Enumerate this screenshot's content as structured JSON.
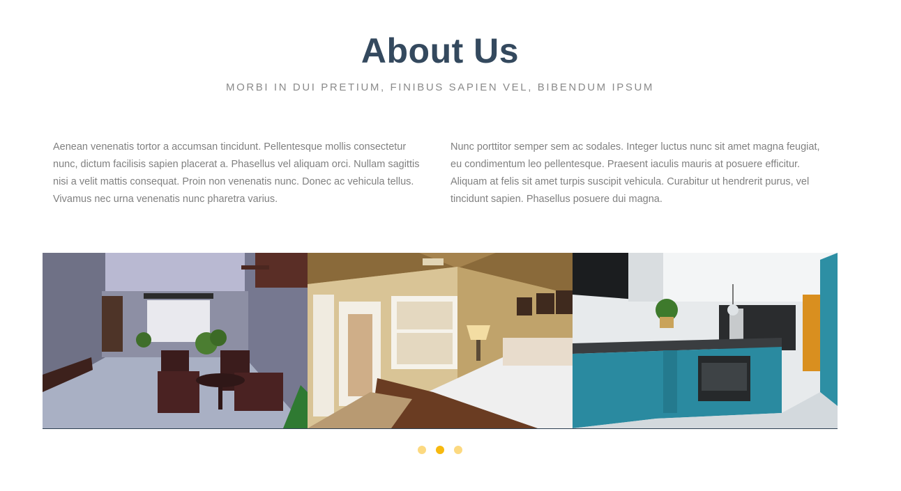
{
  "section": {
    "title": "About Us",
    "subtitle": "MORBI IN DUI PRETIUM, FINIBUS SAPIEN VEL, BIBENDUM IPSUM"
  },
  "columns": [
    {
      "text": "Aenean venenatis tortor a accumsan tincidunt. Pellentesque mollis consectetur nunc, dictum facilisis sapien placerat a. Phasellus vel aliquam orci. Nullam sagittis nisi a velit mattis consequat. Proin non venenatis nunc. Donec ac vehicula tellus. Vivamus nec urna venenatis nunc pharetra varius."
    },
    {
      "text": "Nunc porttitor semper sem ac sodales. Integer luctus nunc sit amet magna feugiat, eu condimentum leo pellentesque. Praesent iaculis mauris at posuere efficitur. Aliquam at felis sit amet turpis suscipit vehicula. Curabitur ut hendrerit purus, vel tincidunt sapien. Phasellus posuere dui magna."
    }
  ],
  "carousel": {
    "slides": [
      {
        "name": "courtyard-photo"
      },
      {
        "name": "bedroom-photo"
      },
      {
        "name": "kitchen-photo"
      }
    ],
    "dots": 3,
    "active_dot": 1
  },
  "colors": {
    "title": "#34495e",
    "subtitle": "#8a8a8a",
    "body_text": "#808080",
    "dot": "#fcd980",
    "dot_active": "#f7b90f"
  }
}
